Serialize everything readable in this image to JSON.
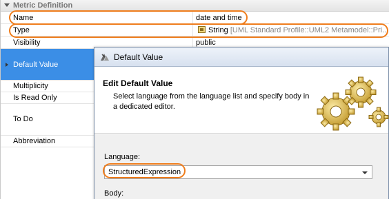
{
  "section": {
    "title": "Metric Definition"
  },
  "rows": [
    {
      "name": "Name",
      "value": "date and time"
    },
    {
      "name": "Type",
      "value_type": "String",
      "value_qualifier": "[UML Standard Profile::UML2 Metamodel::Pri..."
    },
    {
      "name": "Visibility",
      "value": "public"
    },
    {
      "name": "Default Value",
      "value": ""
    },
    {
      "name": "Multiplicity",
      "value": ""
    },
    {
      "name": "Is Read Only",
      "value": ""
    },
    {
      "name": "To Do",
      "value": ""
    },
    {
      "name": "Abbreviation",
      "value": ""
    }
  ],
  "dialog": {
    "title": "Default Value",
    "heading": "Edit Default Value",
    "description": "Select language from the language list and specify body in a dedicated editor.",
    "language_label": "Language:",
    "language_value": "StructuredExpression",
    "body_label": "Body:"
  },
  "colors": {
    "highlight": "#ef7d1c",
    "selection": "#3b8ee6"
  },
  "icons": {
    "section_toggle": "triangle-down-icon",
    "type": "class-icon",
    "dialog": "app-icon",
    "banner": "gears-icon",
    "combo": "chevron-down-icon"
  }
}
